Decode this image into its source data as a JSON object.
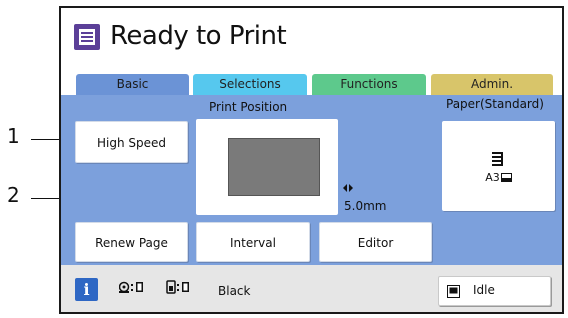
{
  "header": {
    "title": "Ready to Print",
    "icon": "document-list-icon",
    "icon_color": "#5b3f98"
  },
  "tabs": [
    {
      "label": "Basic",
      "color": "#6b93d6",
      "selected": true
    },
    {
      "label": "Selections",
      "color": "#56c8ee",
      "selected": false
    },
    {
      "label": "Functions",
      "color": "#5dc98c",
      "selected": false
    },
    {
      "label": "Admin.",
      "color": "#d8c56a",
      "selected": false
    }
  ],
  "basic": {
    "high_speed_label": "High Speed",
    "print_position_label": "Print Position",
    "print_position_offset": "5.0mm",
    "paper_label": "Paper(Standard)",
    "paper_size": "A3",
    "renew_page_label": "Renew Page",
    "interval_label": "Interval",
    "editor_label": "Editor"
  },
  "status": {
    "info_label": "i",
    "ink_color": "Black",
    "idle_label": "Idle"
  },
  "callouts": [
    "1",
    "2"
  ],
  "colors": {
    "panel_blue": "#7ca0dc",
    "status_bar": "#e6e6e6",
    "info_blue": "#2e67c4"
  }
}
